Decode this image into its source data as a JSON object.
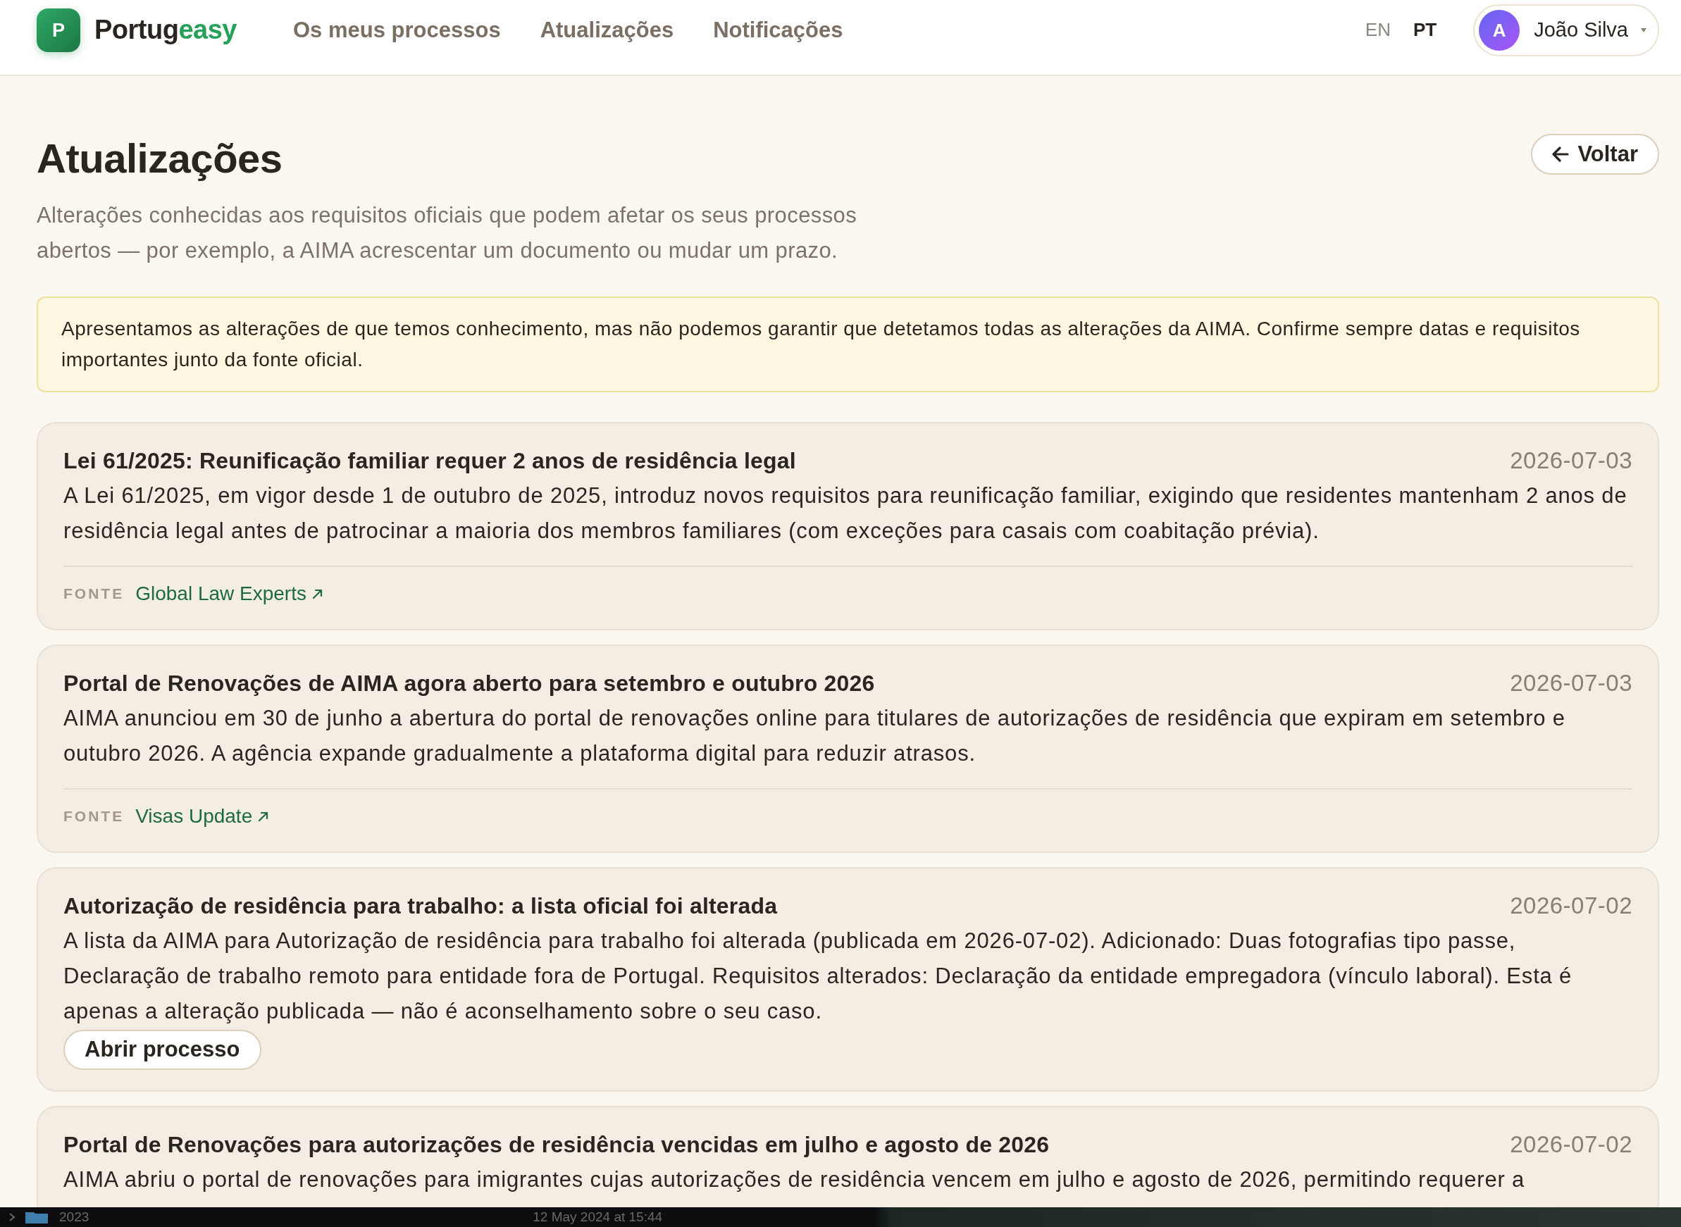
{
  "navbar": {
    "logo": {
      "letter": "P",
      "wordmark_dark": "Portug",
      "wordmark_accent": "easy"
    },
    "links": [
      "Os meus processos",
      "Atualizações",
      "Notificações"
    ],
    "languages": [
      {
        "code": "EN",
        "selected": false
      },
      {
        "code": "PT",
        "selected": true
      }
    ],
    "user_menu": {
      "avatar_initial": "A",
      "name": "João Silva"
    }
  },
  "header": {
    "title": "Atualizações",
    "subtitle": "Alterações conhecidas aos requisitos oficiais que podem afetar os seus processos abertos — por exemplo, a AIMA acrescentar um documento ou mudar um prazo.",
    "back_button": "Voltar"
  },
  "notice": "Apresentamos as alterações de que temos conhecimento, mas não podemos garantir que detetamos todas as alterações da AIMA. Confirme sempre datas e requisitos importantes junto da fonte oficial.",
  "updates": [
    {
      "title": "Lei 61/2025: Reunificação familiar requer 2 anos de residência legal",
      "date": "2026-07-03",
      "body": "A Lei 61/2025, em vigor desde 1 de outubro de 2025, introduz novos requisitos para reunificação familiar, exigindo que residentes mantenham 2 anos de residência legal antes de patrocinar a maioria dos membros familiares (com exceções para casais com coabitação prévia).",
      "source": {
        "label": "FONTE",
        "link": "Global Law Experts"
      }
    },
    {
      "title": "Portal de Renovações de AIMA agora aberto para setembro e outubro 2026",
      "date": "2026-07-03",
      "body": "AIMA anunciou em 30 de junho a abertura do portal de renovações online para titulares de autorizações de residência que expiram em setembro e outubro 2026. A agência expande gradualmente a plataforma digital para reduzir atrasos.",
      "source": {
        "label": "FONTE",
        "link": "Visas Update"
      }
    },
    {
      "title": "Autorização de residência para trabalho: a lista oficial foi alterada",
      "date": "2026-07-02",
      "body": "A lista da AIMA para Autorização de residência para trabalho foi alterada (publicada em 2026-07-02). Adicionado: Duas fotografias tipo passe, Declaração de trabalho remoto para entidade fora de Portugal. Requisitos alterados: Declaração da entidade empregadora (vínculo laboral). Esta é apenas a alteração publicada — não é aconselhamento sobre o seu caso.",
      "action": "Abrir processo"
    },
    {
      "title": "Portal de Renovações para autorizações de residência vencidas em julho e agosto de 2026",
      "date": "2026-07-02",
      "body": "AIMA abriu o portal de renovações para imigrantes cujas autorizações de residência vencem em julho e agosto de 2026, permitindo requerer a"
    }
  ],
  "background_window_strip": {
    "folder": "2023",
    "date_modified": "12 May 2024 at 15:44"
  }
}
